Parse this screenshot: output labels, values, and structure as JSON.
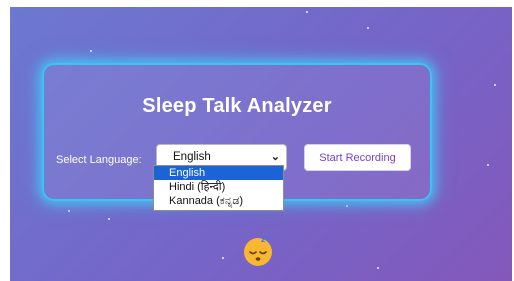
{
  "app": {
    "title": "Sleep Talk Analyzer"
  },
  "form": {
    "language_label": "Select Language:",
    "selected_language": "English",
    "options": [
      "English",
      "Hindi (हिन्दी)",
      "Kannada (ಕನ್ನಡ)"
    ],
    "record_button": "Start Recording"
  },
  "icons": {
    "select_chevron": "chevron-down-icon",
    "mascot": "sleeping-face-emoji"
  },
  "colors": {
    "background_start": "#6c78d2",
    "background_end": "#8458bb",
    "card_glow": "#37c6f0",
    "button_text": "#7b3fc9",
    "option_highlight": "#1a64d6"
  }
}
